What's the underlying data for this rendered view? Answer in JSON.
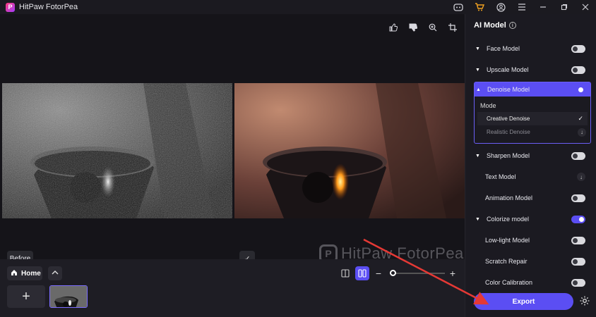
{
  "app": {
    "title": "HitPaw FotorPea",
    "logo_letter": "P"
  },
  "titlebar_icons": [
    "discord-icon",
    "cart-icon",
    "account-icon",
    "menu-icon",
    "minimize-icon",
    "maximize-icon",
    "close-icon"
  ],
  "canvas": {
    "tools": [
      "thumbs-up-icon",
      "thumbs-down-icon",
      "zoom-icon",
      "crop-icon"
    ],
    "before_label": "Before",
    "watermark": "HitPaw FotorPea"
  },
  "bottom": {
    "home_label": "Home",
    "zoom_level": 0
  },
  "panel": {
    "title": "AI Model",
    "models": [
      {
        "label": "Face Model",
        "enabled": false
      },
      {
        "label": "Upscale Model",
        "enabled": false
      }
    ],
    "denoise": {
      "label": "Denoise Model",
      "enabled": true,
      "mode_label": "Mode",
      "options": [
        {
          "label": "Creative Denoise",
          "selected": true
        },
        {
          "label": "Realistic Denoise",
          "selected": false
        }
      ]
    },
    "more_models": [
      {
        "label": "Sharpen Model",
        "caret": true,
        "state": "off"
      },
      {
        "label": "Text Model",
        "caret": false,
        "state": "download"
      },
      {
        "label": "Animation Model",
        "caret": false,
        "state": "off"
      },
      {
        "label": "Colorize model",
        "caret": true,
        "state": "on"
      },
      {
        "label": "Low-light Model",
        "caret": false,
        "state": "off"
      },
      {
        "label": "Scratch Repair",
        "caret": false,
        "state": "off"
      },
      {
        "label": "Color Calibration",
        "caret": false,
        "state": "off"
      }
    ],
    "export_label": "Export"
  },
  "colors": {
    "accent": "#5b4ef3",
    "arrow": "#e53935"
  }
}
